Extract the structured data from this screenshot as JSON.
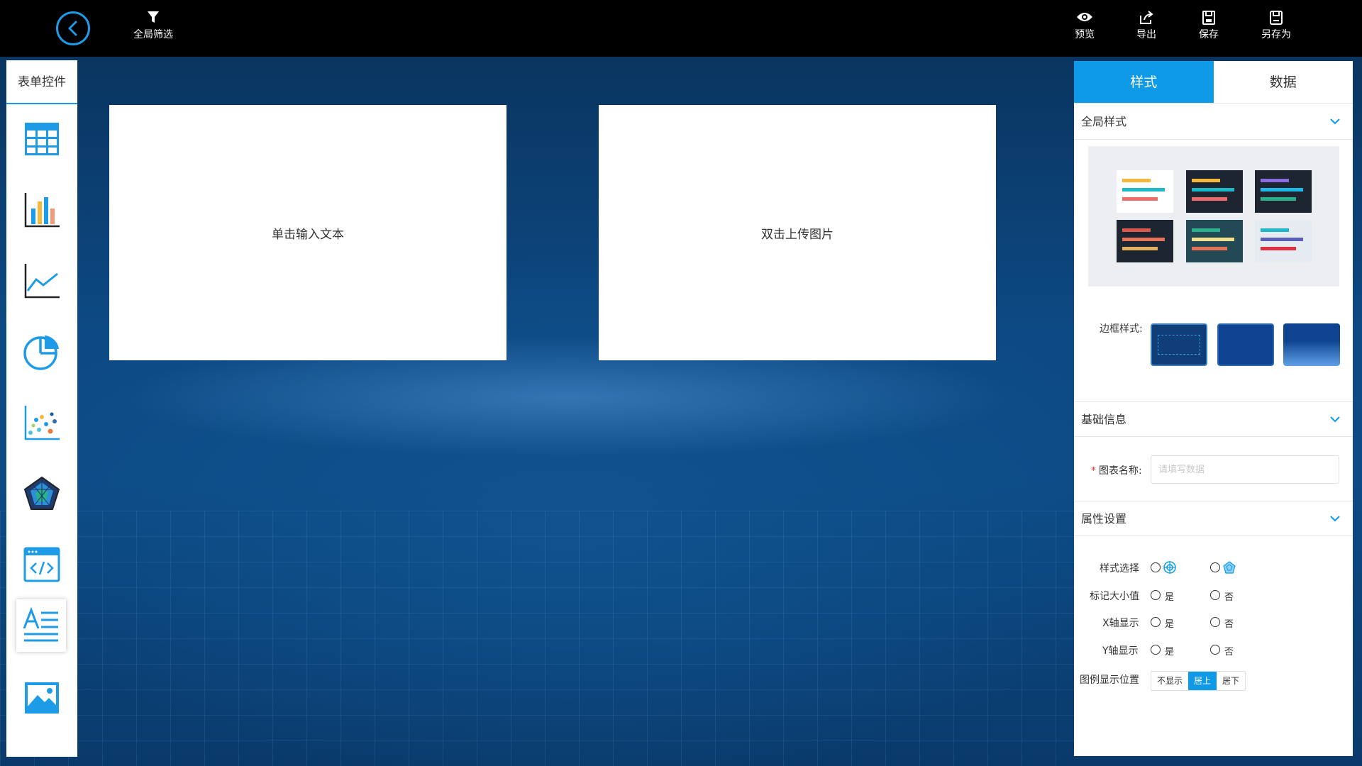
{
  "toolbar": {
    "filter_label": "全局筛选",
    "preview_label": "预览",
    "export_label": "导出",
    "save_label": "保存",
    "save_as_label": "另存为"
  },
  "left_panel": {
    "title": "表单控件",
    "controls": [
      "table-icon",
      "bar-chart-icon",
      "line-chart-icon",
      "pie-chart-icon",
      "scatter-chart-icon",
      "radar-chart-icon",
      "code-embed-icon",
      "text-icon",
      "image-icon"
    ],
    "active": "text-icon"
  },
  "canvas": {
    "text_widget": "单击输入文本",
    "image_widget": "双击上传图片"
  },
  "right_panel": {
    "tabs": [
      "样式",
      "数据"
    ],
    "active_tab": "样式",
    "sections": {
      "global_style": "全局样式",
      "basic_info": "基础信息",
      "properties": "属性设置"
    },
    "border_label": "边框样式:",
    "chart_name_label": "图表名称:",
    "chart_name_placeholder": "请填写数据",
    "props": {
      "style_select": "样式选择",
      "mark_minmax": "标记大小值",
      "x_axis": "X轴显示",
      "y_axis": "Y轴显示",
      "legend_pos": "图例显示位置",
      "yes": "是",
      "no": "否"
    },
    "legend_options": [
      "不显示",
      "居上",
      "居下"
    ],
    "legend_selected": "居上"
  },
  "colors": {
    "accent": "#0e9ae6",
    "topbar": "#000000",
    "background": "#0b3f72"
  }
}
